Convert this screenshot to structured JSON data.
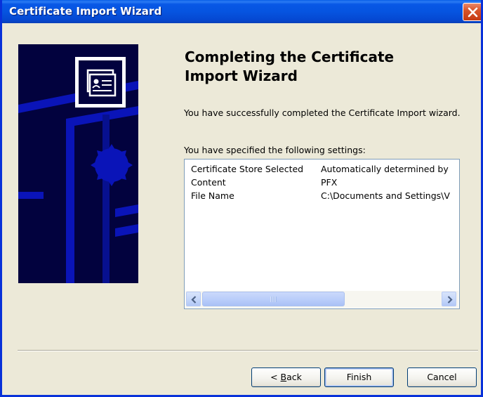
{
  "window": {
    "title": "Certificate Import Wizard"
  },
  "heading": {
    "line1": "Completing the Certificate",
    "line2": "Import Wizard"
  },
  "message": {
    "completed": "You have successfully completed the Certificate Import wizard.",
    "specified": "You have specified the following settings:"
  },
  "settings": [
    {
      "name": "Certificate Store Selected",
      "value": "Automatically determined by"
    },
    {
      "name": "Content",
      "value": "PFX"
    },
    {
      "name": "File Name",
      "value": "C:\\Documents and Settings\\V"
    }
  ],
  "buttons": {
    "back_prefix": "< ",
    "back_mnemonic": "B",
    "back_rest": "ack",
    "finish": "Finish",
    "cancel": "Cancel"
  },
  "icons": {
    "close": "close-x-icon",
    "certificate": "certificate-icon",
    "scroll_left": "arrow-left-icon",
    "scroll_right": "arrow-right-icon"
  },
  "colors": {
    "titlebar": "#0654e0",
    "side_panel": "#02023e",
    "side_accent": "#0a14b8",
    "dialog_bg": "#ece9d8"
  }
}
